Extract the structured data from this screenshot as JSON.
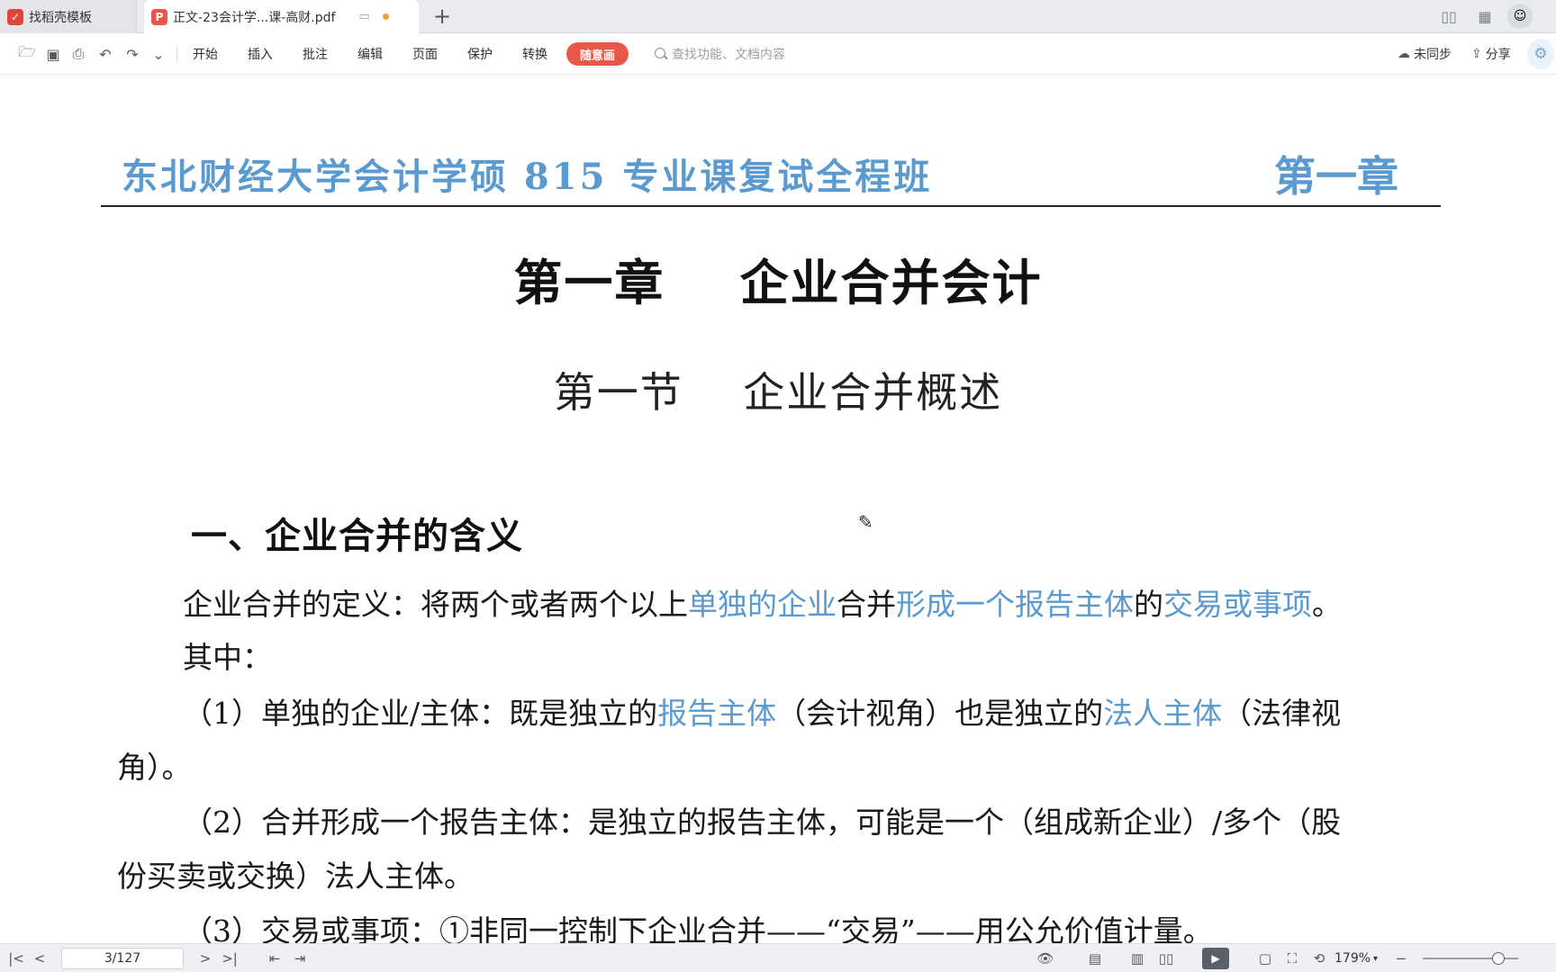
{
  "tabs": [
    {
      "label": "找稻壳模板",
      "active": false
    },
    {
      "label": "正文-23会计学...课-高财.pdf",
      "active": true
    }
  ],
  "toolbar": {
    "menu": [
      "开始",
      "插入",
      "批注",
      "编辑",
      "页面",
      "保护",
      "转换"
    ],
    "highlight_label": "随意画",
    "search_placeholder": "查找功能、文档内容",
    "sync_label": "未同步",
    "share_label": "分享"
  },
  "document": {
    "header_title": "东北财经大学会计学硕 815 专业课复试全程班",
    "header_chapter": "第一章",
    "chapter_title": "第一章    企业合并会计",
    "section_title": "第一节    企业合并概述",
    "heading1": "一、企业合并的含义",
    "para1": {
      "a": "企业合并的定义：将两个或者两个以上",
      "b": "单独的企业",
      "c": "合并",
      "d": "形成一个报告主体",
      "e": "的",
      "f": "交易或事项",
      "g": "。"
    },
    "para1_line2": "其中：",
    "item1": {
      "a": "（1）单独的企业/主体：既是独立的",
      "b": "报告主体",
      "c": "（会计视角）也是独立的",
      "d": "法人主体",
      "e": "（法律视"
    },
    "item1_line2": "角）。",
    "item2": "（2）合并形成一个报告主体：是独立的报告主体，可能是一个（组成新企业）/多个（股",
    "item2_line2": "份买卖或交换）法人主体。",
    "item3": "（3）交易或事项：①非同一控制下企业合并——“交易”——用公允价值计量。"
  },
  "statusbar": {
    "page_indicator": "3/127",
    "zoom": "179%",
    "zoom_fraction": 0.79
  },
  "colors": {
    "accent_blue": "#5a9ad0",
    "highlight_red": "#e8584a"
  }
}
